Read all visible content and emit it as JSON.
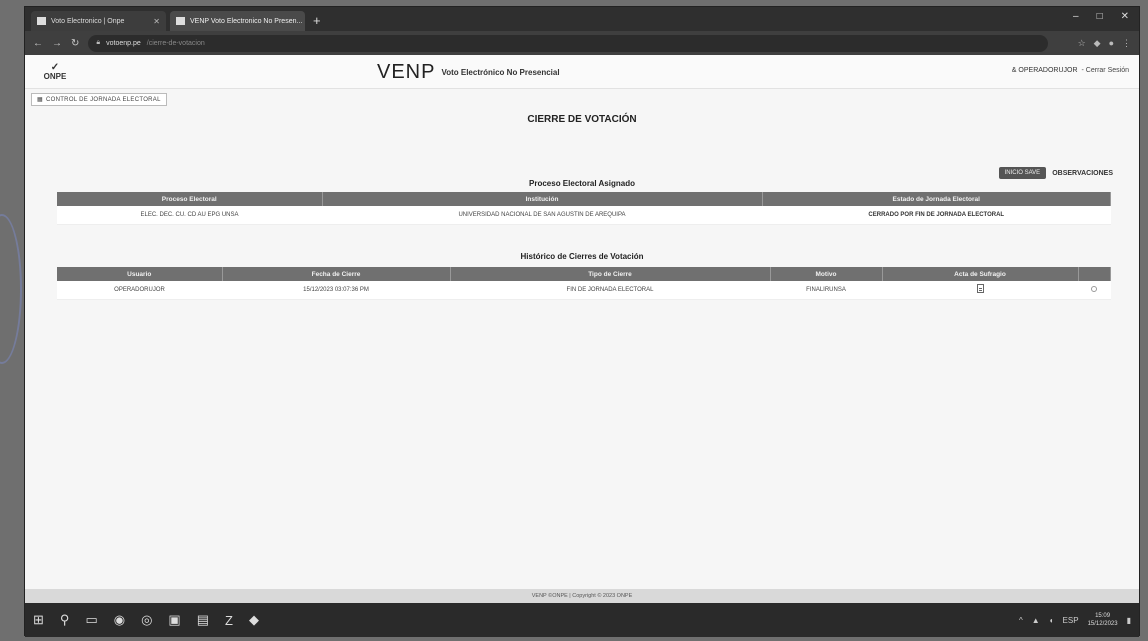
{
  "browser": {
    "tabs": [
      {
        "title": "Voto Electronico | Onpe",
        "active": false
      },
      {
        "title": "VENP Voto Electronico No Presen...",
        "active": true
      }
    ],
    "new_tab": "+",
    "url_host": "votoenp.pe",
    "url_path": "/cierre-de-votacion",
    "window_controls": [
      "–",
      "□",
      "✕"
    ]
  },
  "header": {
    "logo_mark": "✓",
    "logo_text": "ONPE",
    "brand": "VENP",
    "brand_subtitle": "Voto Electrónico No Presencial",
    "user": "& OPERADORUJOR",
    "logout": "- Cerrar Sesión"
  },
  "control_button": "CONTROL DE JORNADA ELECTORAL",
  "page_title": "CIERRE DE VOTACIÓN",
  "toggles": {
    "primary": "INICIO SAVE",
    "secondary": "OBSERVACIONES"
  },
  "process_section": {
    "title": "Proceso Electoral Asignado",
    "columns": [
      "Proceso Electoral",
      "Institución",
      "Estado de Jornada Electoral"
    ],
    "rows": [
      [
        "ELEC. DEC. CU. CD AU EPG UNSA",
        "UNIVERSIDAD NACIONAL DE SAN AGUSTIN DE AREQUIPA",
        "CERRADO POR FIN DE JORNADA ELECTORAL"
      ]
    ]
  },
  "history_section": {
    "title": "Histórico de Cierres de Votación",
    "columns": [
      "Usuario",
      "Fecha de Cierre",
      "Tipo de Cierre",
      "Motivo",
      "Acta de Sufragio",
      ""
    ],
    "rows": [
      [
        "OPERADORUJOR",
        "15/12/2023 03:07:36 PM",
        "FIN DE JORNADA ELECTORAL",
        "FINALIRUNSA",
        "",
        ""
      ]
    ]
  },
  "footer": "VENP ©ONPE | Copyright © 2023 ONPE",
  "taskbar": {
    "clock_time": "15:09",
    "clock_date": "15/12/2023",
    "tray_lang": "ESP"
  }
}
